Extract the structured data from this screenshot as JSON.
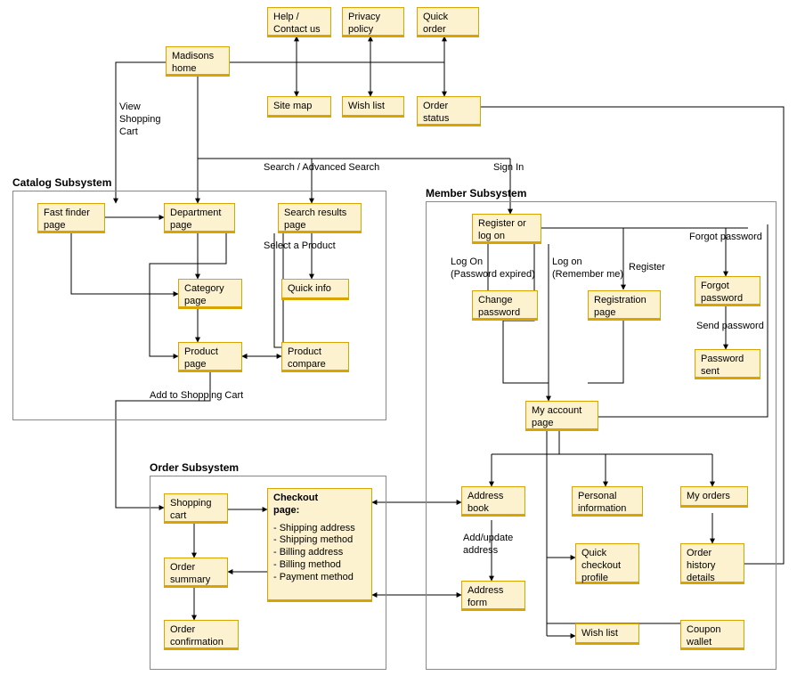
{
  "top": {
    "help": "Help /\nContact us",
    "privacy": "Privacy\npolicy",
    "quick_order": "Quick\norder",
    "madisons": "Madisons\nhome",
    "site_map": "Site map",
    "wish_list": "Wish list",
    "order_status": "Order\nstatus"
  },
  "labels": {
    "view_cart": "View\nShopping\nCart",
    "search": "Search / Advanced Search",
    "sign_in": "Sign In",
    "select_product": "Select a Product",
    "add_to_cart": "Add to Shopping Cart",
    "log_on_pwd_exp": "Log On\n(Password expired)",
    "log_on_remember": "Log on\n(Remember me)",
    "register": "Register",
    "forgot_pwd": "Forgot password",
    "send_pwd": "Send password",
    "add_update_addr": "Add/update\naddress"
  },
  "regions": {
    "catalog": "Catalog Subsystem",
    "order": "Order Subsystem",
    "member": "Member Subsystem"
  },
  "catalog": {
    "fast_finder": "Fast finder\npage",
    "department": "Department\npage",
    "search_results": "Search results\npage",
    "category": "Category\npage",
    "quick_info": "Quick info",
    "product_page": "Product\npage",
    "product_compare": "Product\ncompare"
  },
  "order": {
    "shopping_cart": "Shopping\ncart",
    "order_summary": "Order\nsummary",
    "order_confirmation": "Order\nconfirmation",
    "checkout_title": "Checkout\npage:",
    "checkout_items": "- Shipping address\n- Shipping method\n- Billing address\n- Billing method\n- Payment method"
  },
  "member": {
    "register_logon": "Register or\nlog on",
    "change_pwd": "Change\npassword",
    "registration": "Registration\npage",
    "forgot_pwd": "Forgot\npassword",
    "pwd_sent": "Password\nsent",
    "my_account": "My account\npage",
    "address_book": "Address\nbook",
    "personal_info": "Personal\ninformation",
    "my_orders": "My orders",
    "quick_checkout": "Quick\ncheckout\nprofile",
    "order_history": "Order\nhistory\ndetails",
    "address_form": "Address\nform",
    "wish_list": "Wish list",
    "coupon_wallet": "Coupon\nwallet"
  }
}
